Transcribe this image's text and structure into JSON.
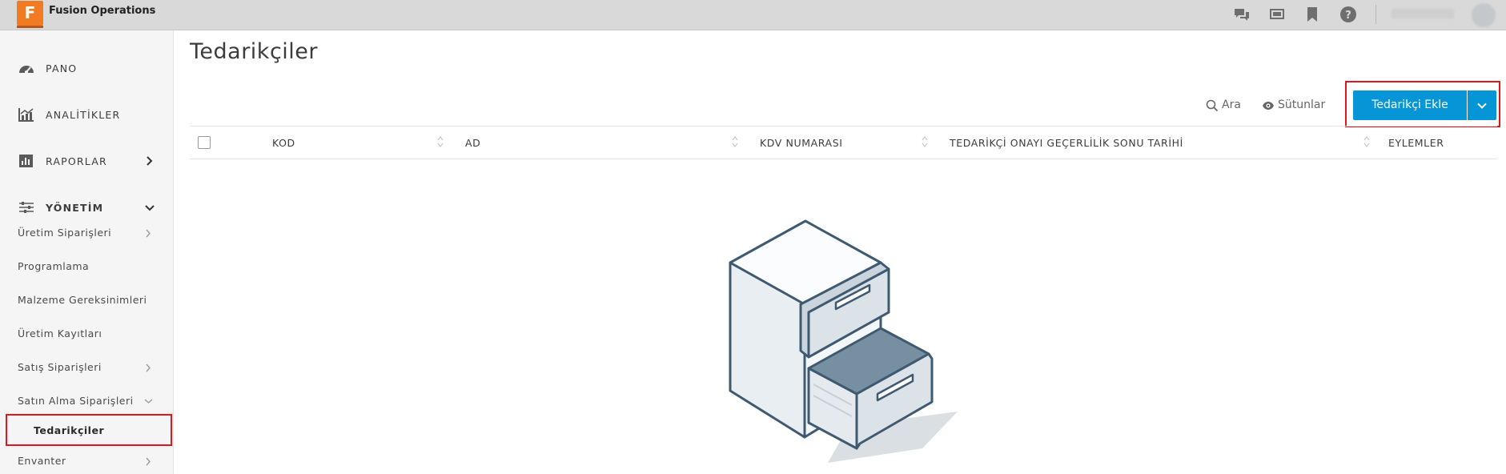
{
  "app": {
    "title": "Fusion Operations",
    "logo_letter": "F"
  },
  "topbar": {
    "icons": [
      "chat-icon",
      "presentation-icon",
      "bookmark-icon",
      "help-icon"
    ]
  },
  "sidebar": {
    "main_items": [
      {
        "label": "PANO",
        "icon": "dashboard-icon"
      },
      {
        "label": "ANALİTİKLER",
        "icon": "analytics-icon"
      },
      {
        "label": "RAPORLAR",
        "icon": "reports-icon"
      },
      {
        "label": "YÖNETİM",
        "icon": "management-icon"
      }
    ],
    "sub_items": [
      {
        "label": "Üretim Siparişleri"
      },
      {
        "label": "Programlama"
      },
      {
        "label": "Malzeme Gereksinimleri"
      },
      {
        "label": "Üretim Kayıtları"
      },
      {
        "label": "Satış Siparişleri"
      },
      {
        "label": "Satın Alma Siparişleri"
      },
      {
        "label": "Tedarikçiler"
      },
      {
        "label": "Envanter"
      }
    ]
  },
  "main": {
    "page_title": "Tedarikçiler",
    "toolbar": {
      "search_label": "Ara",
      "columns_label": "Sütunlar",
      "add_button_label": "Tedarikçi Ekle"
    },
    "table": {
      "columns": [
        "KOD",
        "AD",
        "KDV NUMARASI",
        "TEDARİKÇİ ONAYI GEÇERLİLİK SONU TARİHİ",
        "EYLEMLER"
      ],
      "rows": []
    }
  },
  "colors": {
    "accent": "#0696d7",
    "brand": "#f07b23",
    "highlight": "#e0161d"
  }
}
